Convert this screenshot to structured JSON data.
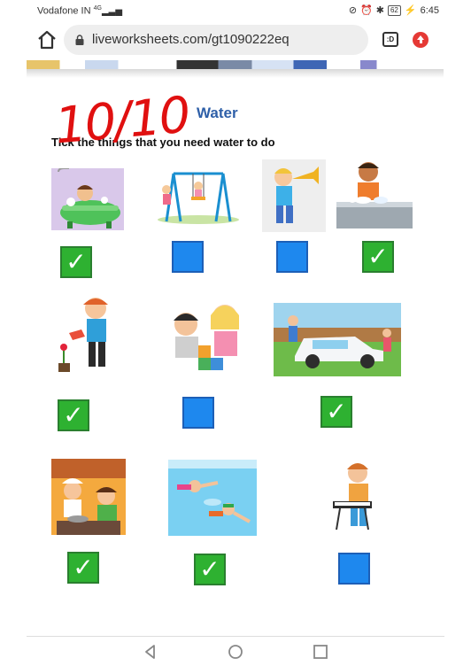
{
  "status_bar": {
    "carrier": "Vodafone IN",
    "signal": "4G",
    "battery": "62",
    "time": "6:45"
  },
  "browser": {
    "url": "liveworksheets.com/gt1090222eq",
    "tabs_count": ":D"
  },
  "worksheet": {
    "title": "Water",
    "instruction": "Tick the things that you need water to do",
    "score": "10/10",
    "items": [
      {
        "activity": "bathing",
        "checked": true,
        "tick": "✓"
      },
      {
        "activity": "swinging",
        "checked": false,
        "tick": ""
      },
      {
        "activity": "playing trumpet",
        "checked": false,
        "tick": ""
      },
      {
        "activity": "washing dishes",
        "checked": true,
        "tick": "✓"
      },
      {
        "activity": "watering plants",
        "checked": true,
        "tick": "✓"
      },
      {
        "activity": "playing with blocks",
        "checked": false,
        "tick": ""
      },
      {
        "activity": "washing the car",
        "checked": true,
        "tick": "✓"
      },
      {
        "activity": "cooking",
        "checked": true,
        "tick": "✓"
      },
      {
        "activity": "swimming",
        "checked": true,
        "tick": "✓"
      },
      {
        "activity": "playing keyboard",
        "checked": false,
        "tick": ""
      }
    ]
  },
  "colors": {
    "checked": "#2eb131",
    "unchecked": "#1e88ee",
    "title": "#2e5fa8",
    "score": "#e01010",
    "update_icon": "#e53935"
  }
}
